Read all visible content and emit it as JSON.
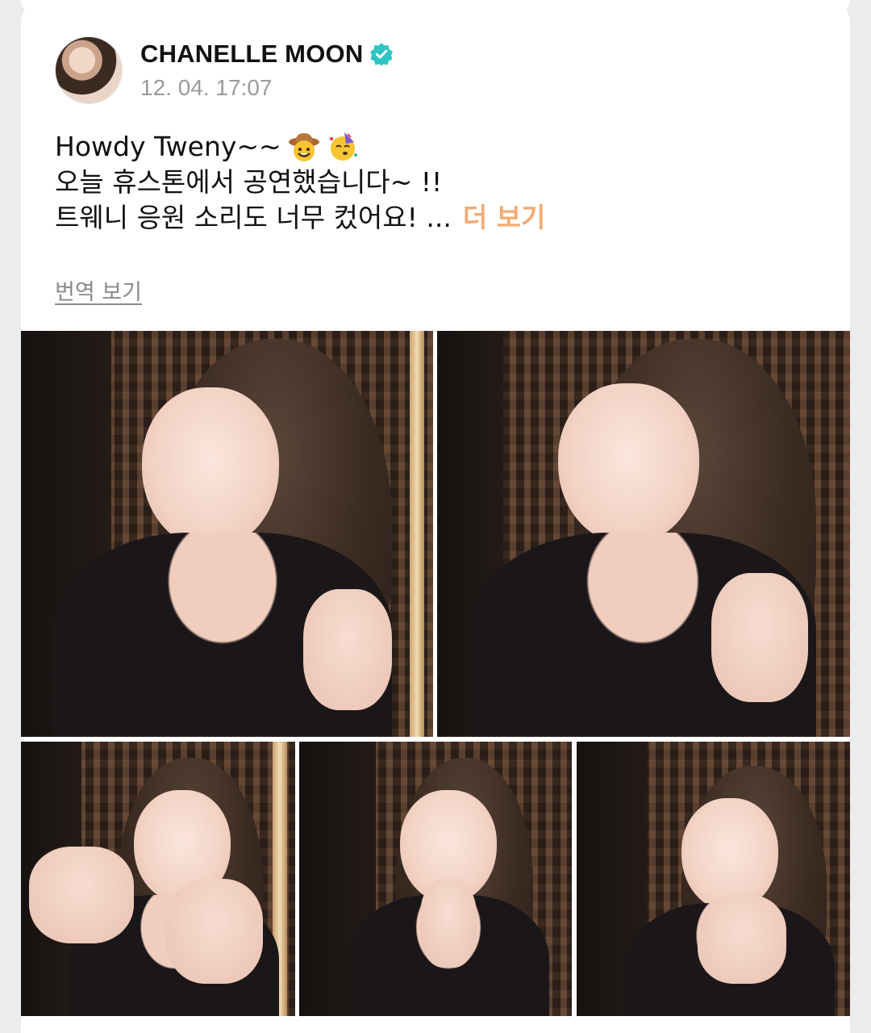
{
  "post": {
    "author_name": "CHANELLE MOON",
    "timestamp": "12. 04. 17:07",
    "lines": [
      "Howdy Tweny~~",
      "오늘 휴스톤에서 공연했습니다~ !!",
      "트웨니 응원 소리도 너무 컸어요! ..."
    ],
    "more_label": "더 보기",
    "translate_label": "번역 보기"
  },
  "icons": {
    "verified": "verified-badge-icon",
    "emoji_1": "cowboy-face-emoji",
    "emoji_2": "partying-face-emoji"
  },
  "colors": {
    "verified_badge": "#2cc5c2",
    "more_link": "#f3ab72",
    "timestamp": "#9b9b9b",
    "background": "#ececec"
  },
  "photos": [
    {
      "description": "photo-1"
    },
    {
      "description": "photo-2"
    },
    {
      "description": "photo-3"
    },
    {
      "description": "photo-4"
    },
    {
      "description": "photo-5"
    }
  ]
}
